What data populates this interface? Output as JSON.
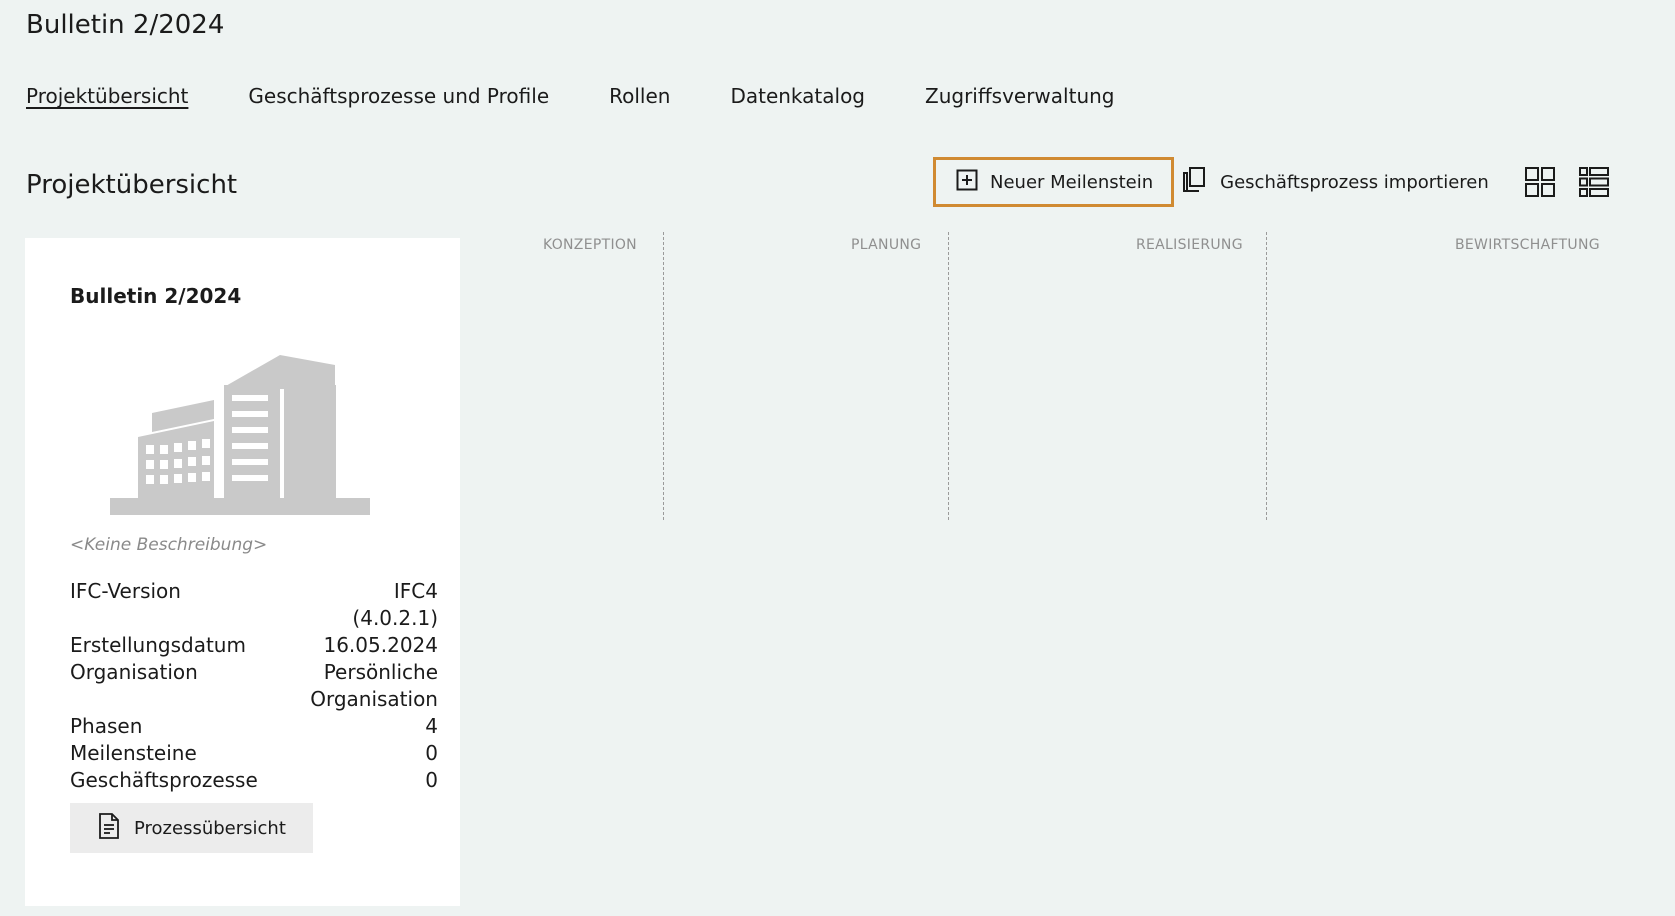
{
  "app": {
    "title": "Bulletin 2/2024"
  },
  "tabs": [
    {
      "label": "Projektübersicht",
      "active": true
    },
    {
      "label": "Geschäftsprozesse und Profile",
      "active": false
    },
    {
      "label": "Rollen",
      "active": false
    },
    {
      "label": "Datenkatalog",
      "active": false
    },
    {
      "label": "Zugriffsverwaltung",
      "active": false
    }
  ],
  "section": {
    "title": "Projektübersicht"
  },
  "toolbar": {
    "new_milestone_label": "Neuer Meilenstein",
    "import_label": "Geschäftsprozess importieren",
    "grid_view_icon": "grid-view-icon",
    "list_view_icon": "list-view-icon",
    "highlight_color": "#d08a32"
  },
  "project": {
    "title": "Bulletin 2/2024",
    "image_icon": "building-icon",
    "description": "<Keine Beschreibung>",
    "props": {
      "ifc_label": "IFC-Version",
      "ifc_value_1": "IFC4",
      "ifc_value_2": "(4.0.2.1)",
      "created_label": "Erstellungsdatum",
      "created_value": "16.05.2024",
      "org_label": "Organisation",
      "org_value_1": "Persönliche",
      "org_value_2": "Organisation",
      "phases_label": "Phasen",
      "phases_value": "4",
      "milestones_label": "Meilensteine",
      "milestones_value": "0",
      "processes_label": "Geschäftsprozesse",
      "processes_value": "0"
    },
    "process_button_label": "Prozessübersicht"
  },
  "phases": [
    {
      "label": "KONZEPTION"
    },
    {
      "label": "PLANUNG"
    },
    {
      "label": "REALISIERUNG"
    },
    {
      "label": "BEWIRTSCHAFTUNG"
    }
  ]
}
